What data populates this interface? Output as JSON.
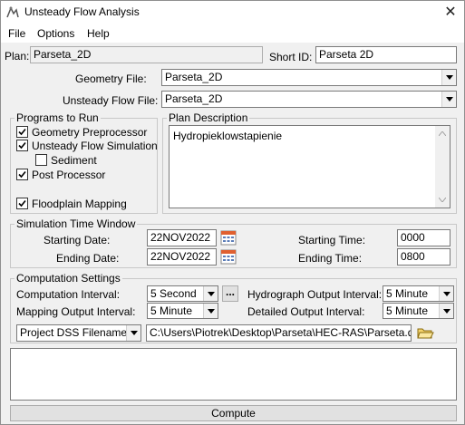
{
  "window": {
    "title": "Unsteady Flow Analysis",
    "close_glyph": "✕"
  },
  "menu": {
    "file": "File",
    "options": "Options",
    "help": "Help"
  },
  "plan": {
    "label": "Plan:",
    "value": "Parseta_2D",
    "short_id_label": "Short ID:",
    "short_id_value": "Parseta 2D"
  },
  "geometry": {
    "label": "Geometry File:",
    "value": "Parseta_2D"
  },
  "unsteady": {
    "label": "Unsteady Flow File:",
    "value": "Parseta_2D"
  },
  "programs": {
    "title": "Programs to Run",
    "geometry_preprocessor": {
      "label": "Geometry Preprocessor",
      "checked": true
    },
    "unsteady_simulation": {
      "label": "Unsteady Flow Simulation",
      "checked": true
    },
    "sediment": {
      "label": "Sediment",
      "checked": false
    },
    "post_processor": {
      "label": "Post Processor",
      "checked": true
    },
    "floodplain_mapping": {
      "label": "Floodplain Mapping",
      "checked": true
    }
  },
  "description": {
    "title": "Plan Description",
    "text": "Hydropieklowstapienie"
  },
  "sim_window": {
    "title": "Simulation Time Window",
    "starting_date_label": "Starting Date:",
    "starting_date": "22NOV2022",
    "ending_date_label": "Ending Date:",
    "ending_date": "22NOV2022",
    "starting_time_label": "Starting Time:",
    "starting_time": "0000",
    "ending_time_label": "Ending Time:",
    "ending_time": "0800"
  },
  "computation": {
    "title": "Computation Settings",
    "comp_interval_label": "Computation Interval:",
    "comp_interval": "5 Second",
    "more_button": "...",
    "hydrograph_label": "Hydrograph Output Interval:",
    "hydrograph_interval": "5 Minute",
    "mapping_label": "Mapping Output Interval:",
    "mapping_interval": "5 Minute",
    "detailed_label": "Detailed Output Interval:",
    "detailed_interval": "5 Minute",
    "dss_label": "Project DSS Filename:",
    "dss_path": "C:\\Users\\Piotrek\\Desktop\\Parseta\\HEC-RAS\\Parseta.dss"
  },
  "compute_button": "Compute",
  "colors": {
    "background": "#f0f0f0",
    "field_border": "#7a7a7a",
    "group_border": "#c8c8c8"
  }
}
